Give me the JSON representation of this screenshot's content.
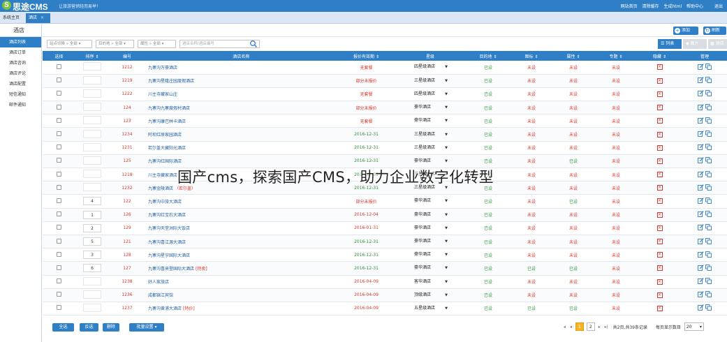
{
  "topbar": {
    "logo_text": "思途CMS",
    "slogan": "让旅游营销轻而易举！",
    "links": [
      "网站首页",
      "清除缓存",
      "生成html",
      "帮助中心",
      "退出"
    ]
  },
  "tabs": {
    "home": "系统主页",
    "hotel": "酒店",
    "close": "×"
  },
  "sidebar": {
    "title": "酒店",
    "items": [
      "酒店列表",
      "酒店订单",
      "酒店咨询",
      "酒店评论",
      "酒店配置",
      "短信通知",
      "邮件通知"
    ]
  },
  "toolbar": {
    "add": "添加",
    "refresh": "刷新"
  },
  "filters": {
    "f1": "站点切换 » 全部 ▾",
    "f2": "目的地 » 全部 ▾",
    "f3": "属性 » 全部 ▾",
    "search_placeholder": "酒店名称/酒店编号"
  },
  "views": {
    "list": "列表",
    "image": "图片",
    "more": "酒店"
  },
  "table": {
    "headers": [
      "选择",
      "排序 ⇕",
      "编号",
      "酒店名称",
      "报价有效期 ⇕",
      "星级",
      "目的地 ⇕",
      "图标 ⇕",
      "属性 ⇕",
      "专题 ⇕",
      "隐藏 ⇕",
      "管理"
    ],
    "rows": [
      {
        "sort": "",
        "id": "1212",
        "name": "九寨沟万豪酒店",
        "tag": "",
        "price": "无套餐",
        "pc": "red",
        "star": "四星级酒店",
        "dest": "已设",
        "icon": "未设",
        "attr": "未设",
        "topic": "未设"
      },
      {
        "sort": "",
        "id": "1219",
        "name": "九寨沟星隆庄园度假酒店",
        "tag": "",
        "price": "部分未报价",
        "pc": "red",
        "star": "三星级酒店",
        "dest": "已设",
        "icon": "未设",
        "attr": "未设",
        "topic": "未设"
      },
      {
        "sort": "",
        "id": "1222",
        "name": "川主寺藏家山庄",
        "tag": "",
        "price": "无套餐",
        "pc": "red",
        "star": "四星级酒店",
        "dest": "已设",
        "icon": "未设",
        "attr": "未设",
        "topic": "未设"
      },
      {
        "sort": "",
        "id": "124",
        "name": "九寨沟九寨度假村酒店",
        "tag": "",
        "price": "部分未报价",
        "pc": "red",
        "star": "豪华酒店",
        "dest": "已设",
        "icon": "未设",
        "attr": "未设",
        "topic": "未设"
      },
      {
        "sort": "",
        "id": "123",
        "name": "九寨沟康巴林卡酒店",
        "tag": "",
        "price": "无套餐",
        "pc": "red",
        "star": "豪华酒店",
        "dest": "已设",
        "icon": "未设",
        "attr": "未设",
        "topic": "未设"
      },
      {
        "sort": "",
        "id": "1234",
        "name": "阿坝红原家园酒店",
        "tag": "",
        "price": "2016-12-31",
        "pc": "green",
        "star": "三星级酒店",
        "dest": "已设",
        "icon": "未设",
        "attr": "未设",
        "topic": "未设"
      },
      {
        "sort": "",
        "id": "1231",
        "name": "若尔盖大藏阳光酒店",
        "tag": "",
        "price": "2016-12-31",
        "pc": "green",
        "star": "三星级酒店",
        "dest": "已设",
        "icon": "未设",
        "attr": "未设",
        "topic": "未设"
      },
      {
        "sort": "",
        "id": "125",
        "name": "九寨沟红国际酒店",
        "tag": "",
        "price": "2016-12-31",
        "pc": "green",
        "star": "豪华酒店",
        "dest": "已设",
        "icon": "未设",
        "attr": "已设",
        "topic": "未设"
      },
      {
        "sort": "",
        "id": "1218",
        "name": "川主寺藏家酒店",
        "tag": "",
        "price": "2016-12-31",
        "pc": "green",
        "star": "三星级酒店",
        "dest": "已设",
        "icon": "未设",
        "attr": "未设",
        "topic": "未设"
      },
      {
        "sort": "",
        "id": "1232",
        "name": "九寨金陵酒店",
        "tag": "（若尔盖）",
        "price": "2016-12-31",
        "pc": "green",
        "star": "三星级酒店",
        "dest": "已设",
        "icon": "未设",
        "attr": "未设",
        "topic": "未设"
      },
      {
        "sort": "4",
        "id": "122",
        "name": "九寨沟中旅大酒店",
        "tag": "",
        "price": "部分未报价",
        "pc": "red",
        "star": "豪华酒店",
        "dest": "已设",
        "icon": "未设",
        "attr": "已设",
        "topic": "未设"
      },
      {
        "sort": "1",
        "id": "126",
        "name": "九寨沟红宝石大酒店",
        "tag": "",
        "price": "2016-12-04",
        "pc": "red",
        "star": "豪华酒店",
        "dest": "已设",
        "icon": "未设",
        "attr": "未设",
        "topic": "未设"
      },
      {
        "sort": "2",
        "id": "129",
        "name": "九寨沟天堂洲际大饭店",
        "tag": "",
        "price": "2016-01-31",
        "pc": "red",
        "star": "豪华酒店",
        "dest": "已设",
        "icon": "未设",
        "attr": "未设",
        "topic": "未设"
      },
      {
        "sort": "5",
        "id": "121",
        "name": "九寨沟喜江源大酒店",
        "tag": "",
        "price": "2016-12-31",
        "pc": "green",
        "star": "豪华酒店",
        "dest": "已设",
        "icon": "未设",
        "attr": "未设",
        "topic": "未设"
      },
      {
        "sort": "3",
        "id": "128",
        "name": "九寨沟星宇国际大酒店",
        "tag": "",
        "price": "2016-12-31",
        "pc": "green",
        "star": "豪华酒店",
        "dest": "已设",
        "icon": "未设",
        "attr": "未设",
        "topic": "未设"
      },
      {
        "sort": "6",
        "id": "127",
        "name": "九寨沟喜来登国际大酒店",
        "tag": "[特卖]",
        "price": "2016-12-31",
        "pc": "green",
        "star": "豪华酒店",
        "dest": "已设",
        "icon": "已设",
        "attr": "已设",
        "topic": "未设"
      },
      {
        "sort": "",
        "id": "1238",
        "name": "好人家旅店",
        "tag": "",
        "price": "2016-04-09",
        "pc": "red",
        "star": "客华酒店",
        "dest": "已设",
        "icon": "未设",
        "attr": "未设",
        "topic": "未设"
      },
      {
        "sort": "",
        "id": "1236",
        "name": "成都锦江宾馆",
        "tag": "",
        "price": "2016-04-09",
        "pc": "red",
        "star": "顶级酒店",
        "dest": "已设",
        "icon": "未设",
        "attr": "未设",
        "topic": "未设"
      },
      {
        "sort": "",
        "id": "1237",
        "name": "九寨沟黄浦大酒店",
        "tag": "[特价]",
        "price": "2016-04-09",
        "pc": "red",
        "star": "五星级酒店",
        "dest": "已设",
        "icon": "已设",
        "attr": "已设",
        "topic": "未设"
      }
    ]
  },
  "footer": {
    "buttons": [
      "全选",
      "反选",
      "删除",
      "批量设置 ▾"
    ],
    "pager": {
      "first": "◂",
      "prev": "◂",
      "p1": "1",
      "p2": "2",
      "next": "▸",
      "last": "▸|",
      "summary": "共2页,共39条记录",
      "per_page_label": "每页显示数目",
      "per_page": "20"
    }
  },
  "watermark": "国产cms，探索国产CMS，助力企业数字化转型",
  "colors": {
    "primary": "#2f7fc6",
    "red": "#d9342b",
    "green": "#2c9b3a",
    "pager_current": "#f6b325"
  }
}
